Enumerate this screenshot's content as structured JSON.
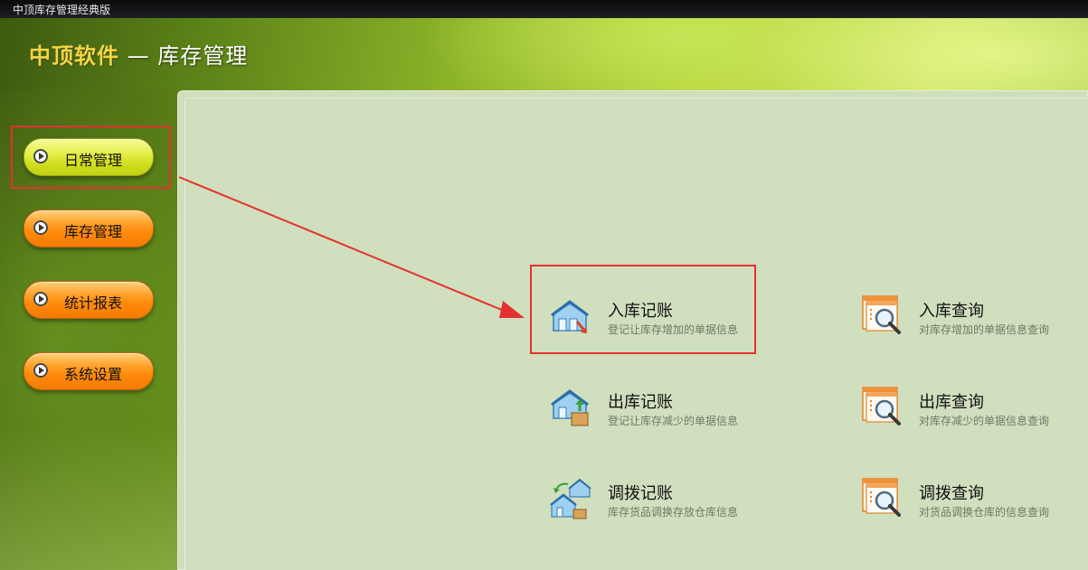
{
  "window": {
    "title": "中顶库存管理经典版"
  },
  "brand": {
    "name": "中顶软件",
    "suffix": "— 库存管理"
  },
  "sidebar": {
    "items": [
      {
        "label": "日常管理",
        "selected": true
      },
      {
        "label": "库存管理",
        "selected": false
      },
      {
        "label": "统计报表",
        "selected": false
      },
      {
        "label": "系统设置",
        "selected": false
      }
    ]
  },
  "main": {
    "items": [
      {
        "title": "入库记账",
        "desc": "登记让库存增加的单据信息",
        "icon": "warehouse-in-icon"
      },
      {
        "title": "入库查询",
        "desc": "对库存增加的单据信息查询",
        "icon": "document-search-icon"
      },
      {
        "title": "出库记账",
        "desc": "登记让库存减少的单据信息",
        "icon": "warehouse-out-icon"
      },
      {
        "title": "出库查询",
        "desc": "对库存减少的单据信息查询",
        "icon": "document-search-icon"
      },
      {
        "title": "调拨记账",
        "desc": "库存货品调换存放仓库信息",
        "icon": "warehouse-transfer-icon"
      },
      {
        "title": "调拨查询",
        "desc": "对货品调换仓库的信息查询",
        "icon": "document-search-icon"
      }
    ]
  },
  "colors": {
    "highlight": "#e53030",
    "panel": "#d0dfbe",
    "nav_orange": "#ff8a0a",
    "nav_yellow": "#cfdd1e"
  }
}
